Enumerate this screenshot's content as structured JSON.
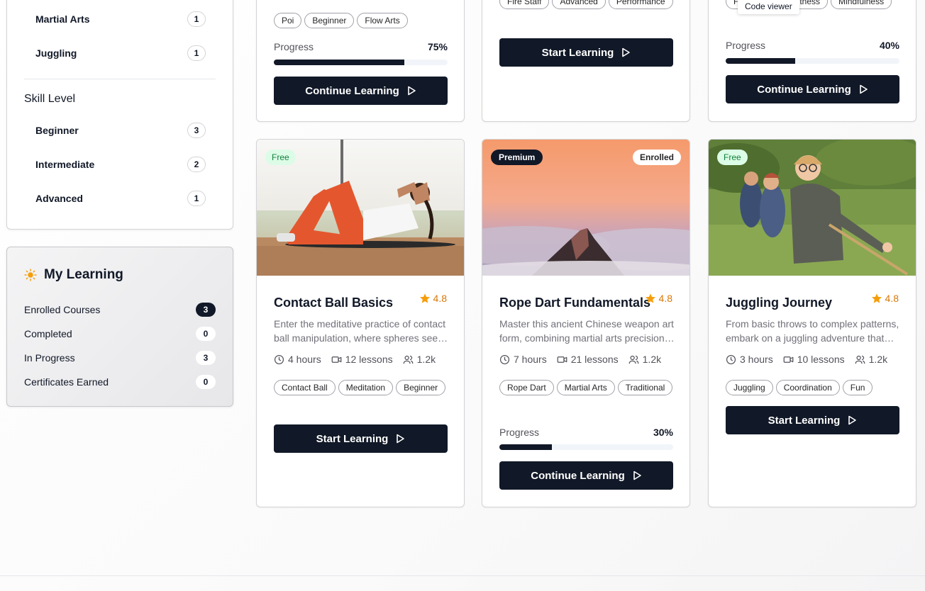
{
  "sidebar": {
    "categories": [
      {
        "label": "Martial Arts",
        "count": "1"
      },
      {
        "label": "Juggling",
        "count": "1"
      }
    ],
    "skill_level_title": "Skill Level",
    "skill_levels": [
      {
        "label": "Beginner",
        "count": "3"
      },
      {
        "label": "Intermediate",
        "count": "2"
      },
      {
        "label": "Advanced",
        "count": "1"
      }
    ]
  },
  "my_learning": {
    "title": "My Learning",
    "icon": "sun-icon",
    "rows": [
      {
        "label": "Enrolled Courses",
        "value": "3"
      },
      {
        "label": "Completed",
        "value": "0"
      },
      {
        "label": "In Progress",
        "value": "3"
      },
      {
        "label": "Certificates Earned",
        "value": "0"
      }
    ]
  },
  "tooltip": "Code viewer",
  "top_cards": [
    {
      "tags": [
        "Poi",
        "Beginner",
        "Flow Arts"
      ],
      "progress_label": "Progress",
      "progress_pct": "75%",
      "progress": 0.75,
      "button": "Continue Learning"
    },
    {
      "tags": [
        "Fire Staff",
        "Advanced",
        "Performance"
      ],
      "button": "Start Learning"
    },
    {
      "tags": [
        "F",
        "Fitness",
        "Mindfulness"
      ],
      "progress_label": "Progress",
      "progress_pct": "40%",
      "progress": 0.4,
      "button": "Continue Learning"
    }
  ],
  "courses": [
    {
      "badge": "Free",
      "title": "Contact Ball Basics",
      "rating": "4.8",
      "description": "Enter the meditative practice of contact ball manipulation, where spheres seem to float effortlessly.",
      "hours": "4 hours",
      "lessons": "12 lessons",
      "students": "1.2k",
      "tags": [
        "Contact Ball",
        "Meditation",
        "Beginner"
      ],
      "button": "Start Learning"
    },
    {
      "badge": "Premium",
      "enrolled": "Enrolled",
      "title": "Rope Dart Fundamentals",
      "rating": "4.8",
      "description": "Master this ancient Chinese weapon art form, combining martial arts precision with flowing movement.",
      "hours": "7 hours",
      "lessons": "21 lessons",
      "students": "1.2k",
      "tags": [
        "Rope Dart",
        "Martial Arts",
        "Traditional"
      ],
      "progress_label": "Progress",
      "progress_pct": "30%",
      "progress": 0.3,
      "button": "Continue Learning"
    },
    {
      "badge": "Free",
      "title": "Juggling Journey",
      "rating": "4.8",
      "description": "From basic throws to complex patterns, embark on a juggling adventure that builds coordination.",
      "hours": "3 hours",
      "lessons": "10 lessons",
      "students": "1.2k",
      "tags": [
        "Juggling",
        "Coordination",
        "Fun"
      ],
      "button": "Start Learning"
    }
  ],
  "colors": {
    "primary": "#111827",
    "star": "#f59e0b",
    "free_bg": "#dcfce7",
    "free_text": "#15803d"
  }
}
